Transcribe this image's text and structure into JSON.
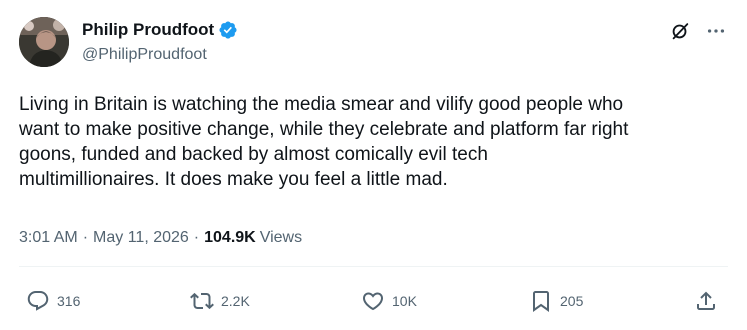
{
  "author": {
    "name": "Philip Proudfoot",
    "handle": "@PhilipProudfoot",
    "verified": true,
    "verified_color": "#1d9bf0"
  },
  "tweet": {
    "lines": [
      "Living in Britain is watching the media smear and vilify good people who",
      "want to make positive change, while they celebrate and platform far right",
      "goons, funded and backed by almost comically evil tech",
      "multimillionaires. It does make you feel a little mad."
    ]
  },
  "meta": {
    "time": "3:01 AM",
    "separator": "·",
    "date": "May 11, 2026",
    "views_count": "104.9K",
    "views_label": "Views"
  },
  "actions": {
    "replies": "316",
    "reposts": "2.2K",
    "likes": "10K",
    "bookmarks": "205"
  },
  "icons": {
    "verified": "verified-badge-icon",
    "grok": "grok-icon",
    "more": "more-horizontal-icon",
    "reply": "reply-icon",
    "repost": "repost-icon",
    "like": "heart-icon",
    "bookmark": "bookmark-icon",
    "share": "share-icon"
  },
  "colors": {
    "text_primary": "#0f1419",
    "text_secondary": "#536471",
    "divider": "#eff3f4"
  }
}
